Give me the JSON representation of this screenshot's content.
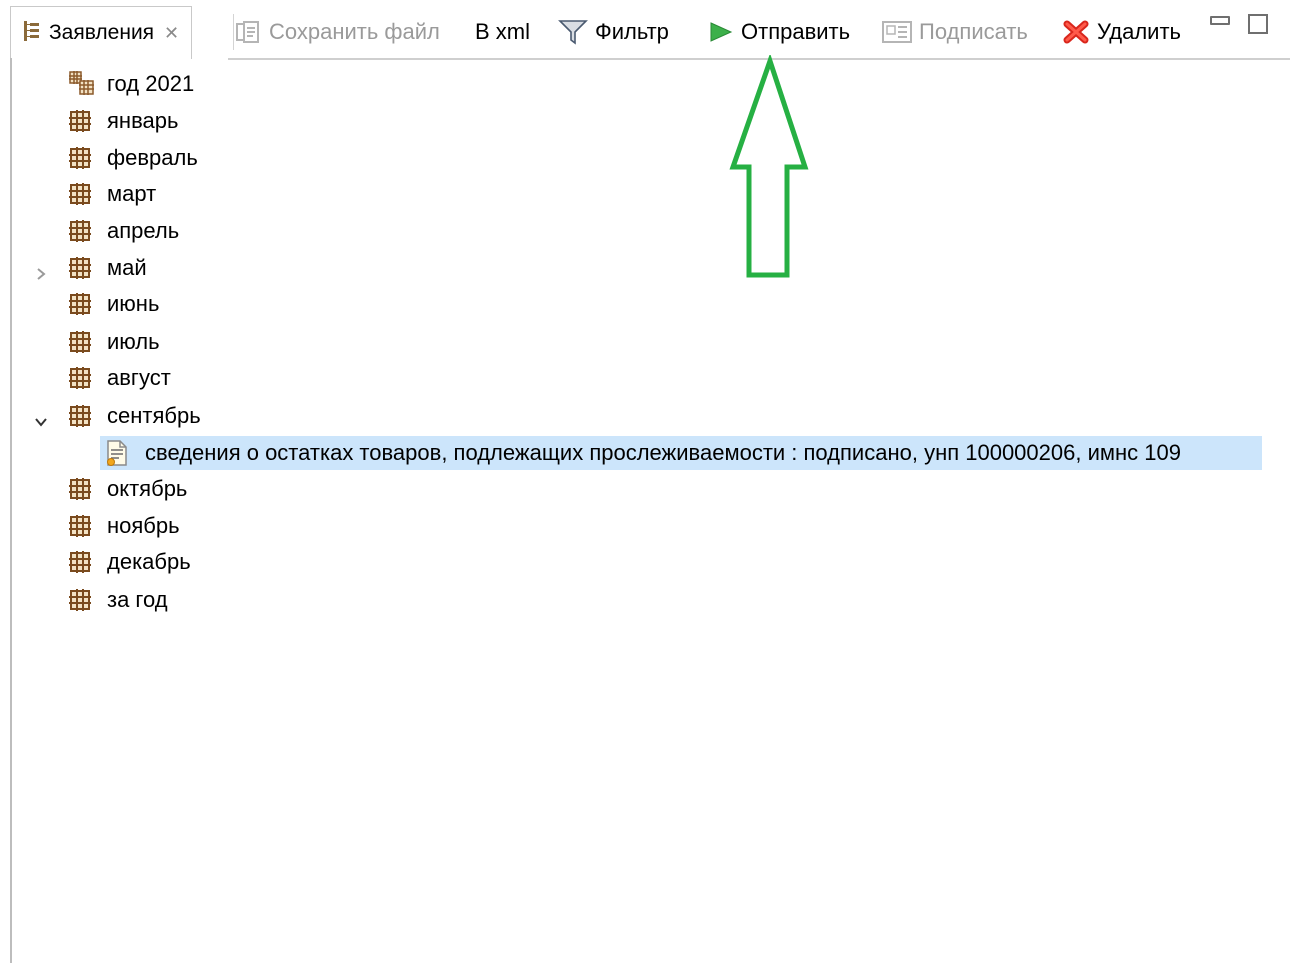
{
  "tab": {
    "label": "Заявления",
    "icon": "tree-view-icon",
    "close_icon": "close-icon"
  },
  "toolbar": {
    "save_file": "Сохранить файл",
    "to_xml": "В xml",
    "filter": "Фильтр",
    "send": "Отправить",
    "sign": "Подписать",
    "delete": "Удалить"
  },
  "tree": {
    "year": "год 2021",
    "months": [
      "январь",
      "февраль",
      "март",
      "апрель",
      "май",
      "июнь",
      "июль",
      "август",
      "сентябрь",
      "октябрь",
      "ноябрь",
      "декабрь",
      "за год"
    ],
    "document": "сведения о остатках товаров, подлежащих прослеживаемости : подписано, унп 100000206, имнс 109"
  },
  "colors": {
    "selection": "#cce5fb",
    "arrow": "#26b043",
    "folder_icon": "#8b5a2b",
    "delete_red": "#e8281c"
  }
}
